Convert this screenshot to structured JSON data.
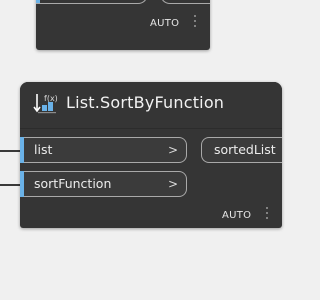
{
  "top_node": {
    "lacing": "AUTO"
  },
  "node": {
    "title": "List.SortByFunction",
    "icon": "sort-by-function-icon",
    "inputs": [
      {
        "label": "list",
        "chevron": ">"
      },
      {
        "label": "sortFunction",
        "chevron": ">"
      }
    ],
    "outputs": [
      {
        "label": "sortedList"
      }
    ],
    "lacing": "AUTO"
  },
  "colors": {
    "canvas": "#f0f0f0",
    "node_body": "#353535",
    "port_accent": "#6ab2e8",
    "port_border": "#a9a9a9"
  }
}
